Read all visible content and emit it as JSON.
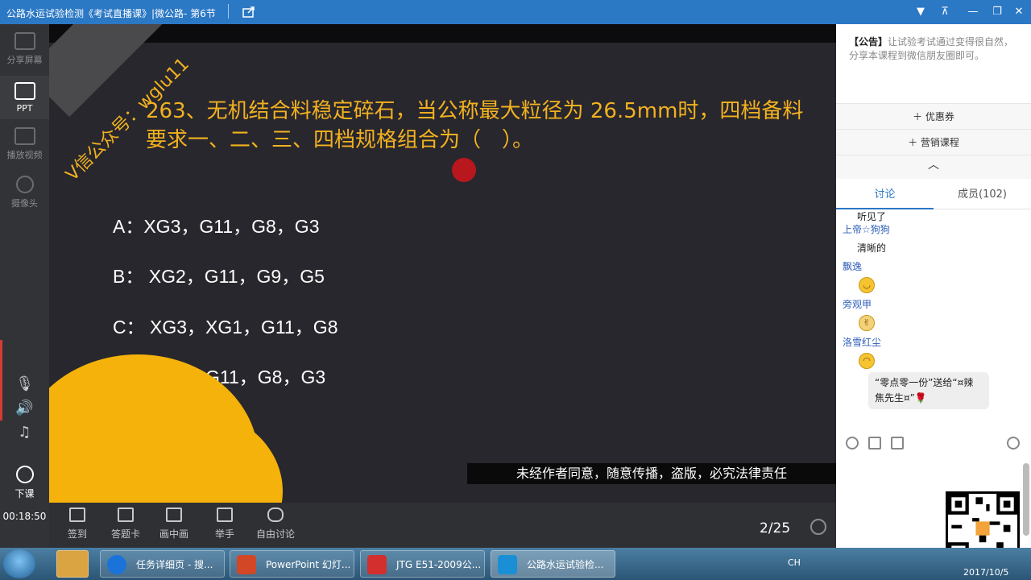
{
  "window": {
    "title": "公路水运试验检测《考试直播课》|微公路- 第6节",
    "controls": [
      "▼",
      "⊼",
      "—",
      "❐",
      "✕"
    ]
  },
  "left_sidebar": {
    "items": [
      {
        "label": "分享屏幕",
        "icon": "share-screen-icon",
        "active": false
      },
      {
        "label": "PPT",
        "icon": "ppt-icon",
        "active": true
      },
      {
        "label": "播放视频",
        "icon": "play-video-icon",
        "active": false
      },
      {
        "label": "摄像头",
        "icon": "camera-icon",
        "active": false
      }
    ],
    "audio_icons": [
      "microphone-icon",
      "speaker-icon",
      "music-icon"
    ],
    "end_class_label": "下课",
    "timer": "00:18:50"
  },
  "slide": {
    "watermark_ribbon": "V信公众号：wglu11",
    "question": "263、无机结合料稳定碎石，当公称最大粒径为 26.5mm时，四档备料要求一、二、三、四档规格组合为（　）。",
    "options": [
      "A：XG3，G11，G8，G3",
      "B： XG2，G11，G9，G5",
      "C： XG3，XG1，G11，G8",
      "D： XG2，G11，G8，G3"
    ],
    "warning": "未经作者同意，随意传播，盗版，必究法律责任"
  },
  "bottom_toolbar": {
    "items": [
      {
        "label": "签到",
        "icon": "checkin-icon"
      },
      {
        "label": "答题卡",
        "icon": "answer-card-icon"
      },
      {
        "label": "画中画",
        "icon": "picture-in-picture-icon"
      },
      {
        "label": "举手",
        "icon": "raise-hand-icon"
      },
      {
        "label": "自由讨论",
        "icon": "free-discussion-icon"
      }
    ],
    "page_indicator": "2/25"
  },
  "right_panel": {
    "notice_label": "【公告】",
    "notice_text": "让试验考试通过变得很自然，分享本课程到微信朋友圈即可。",
    "coupon_button": "＋ 优惠券",
    "marketing_button": "＋ 营销课程",
    "tabs": [
      {
        "label": "讨论",
        "active": true
      },
      {
        "label": "成员(102)",
        "active": false
      }
    ],
    "chat": [
      {
        "type": "text",
        "text": "听见了"
      },
      {
        "type": "user",
        "text": "上帝☆狗狗"
      },
      {
        "type": "text",
        "text": "清晰的"
      },
      {
        "type": "user",
        "text": "飘逸"
      },
      {
        "type": "emoji",
        "emoji": "smile"
      },
      {
        "type": "user",
        "text": "旁观甲"
      },
      {
        "type": "emoji",
        "emoji": "victory"
      },
      {
        "type": "user",
        "text": "洛雪红尘"
      },
      {
        "type": "emoji",
        "emoji": "grin"
      }
    ],
    "gift_message": "“零点零一份”送给“¤辣焦先生¤”🌹",
    "chat_tool_icons": [
      "emoji-icon",
      "scissors-icon",
      "image-icon",
      "settings-icon"
    ]
  },
  "taskbar": {
    "apps": [
      {
        "label": "任务详细页 - 搜...",
        "color": "#1a73d9"
      },
      {
        "label": "PowerPoint 幻灯...",
        "color": "#d24726"
      },
      {
        "label": "JTG E51-2009公...",
        "color": "#d32f2f"
      },
      {
        "label": "公路水运试验检...",
        "color": "#1b8fd6"
      }
    ],
    "tray_lang": "CH",
    "clock_date": "2017/10/5"
  }
}
